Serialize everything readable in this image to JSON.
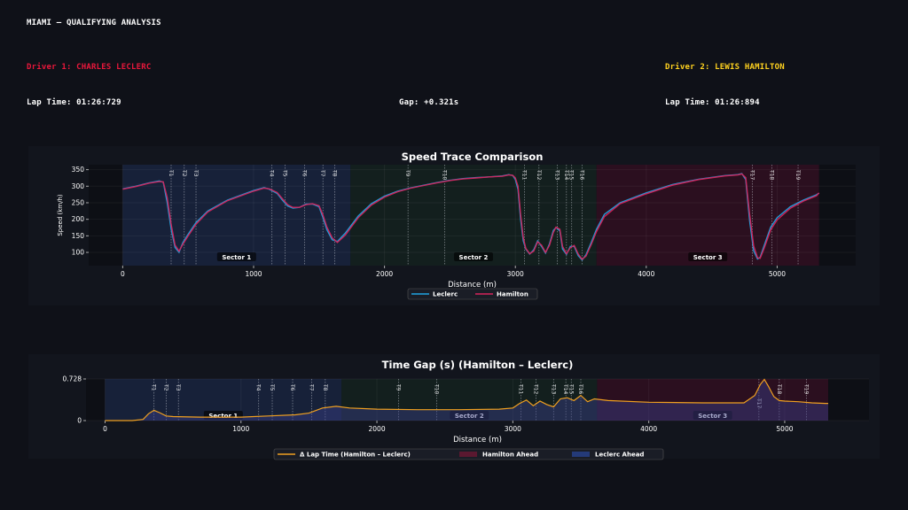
{
  "header": {
    "title": "MIAMI – QUALIFYING ANALYSIS",
    "driver1_label": "Driver 1: CHARLES LECLERC",
    "driver2_label": "Driver 2: LEWIS HAMILTON",
    "lap1": "Lap Time: 01:26:729",
    "gap": "Gap: +0.321s",
    "lap2": "Lap Time: 01:26:894"
  },
  "colors": {
    "background": "#0f1118",
    "panel": "#12151d",
    "leclerc": "#1fa3e0",
    "hamilton": "#d6245c",
    "gap_line": "#f0a020",
    "driver1": "#e8173b",
    "driver2": "#ffd21f",
    "sector1": "#18233d",
    "sector2": "#14211f",
    "sector3": "#2f1020"
  },
  "chart_data": [
    {
      "type": "line",
      "title": "Speed Trace Comparison",
      "xlabel": "Distance (m)",
      "ylabel": "Speed (km/h)",
      "xlim": [
        -260,
        5600
      ],
      "ylim": [
        60,
        365
      ],
      "xticks": [
        0,
        1000,
        2000,
        3000,
        4000,
        5000
      ],
      "yticks": [
        100,
        150,
        200,
        250,
        300,
        350
      ],
      "grid": true,
      "legend_placement": "bottom-center",
      "sectors": [
        {
          "label": "Sector 1",
          "start": 0,
          "end": 1740
        },
        {
          "label": "Sector 2",
          "start": 1740,
          "end": 3620
        },
        {
          "label": "Sector 3",
          "start": 3620,
          "end": 5320
        }
      ],
      "turns": [
        {
          "label": "T1",
          "x": 370
        },
        {
          "label": "T2",
          "x": 470
        },
        {
          "label": "T3",
          "x": 560
        },
        {
          "label": "T4",
          "x": 1140
        },
        {
          "label": "T5",
          "x": 1240
        },
        {
          "label": "T6",
          "x": 1390
        },
        {
          "label": "T7",
          "x": 1530
        },
        {
          "label": "T8",
          "x": 1620
        },
        {
          "label": "T9",
          "x": 2180
        },
        {
          "label": "T10",
          "x": 2460
        },
        {
          "label": "T11",
          "x": 3070
        },
        {
          "label": "T12",
          "x": 3180
        },
        {
          "label": "T13",
          "x": 3320
        },
        {
          "label": "T14",
          "x": 3390
        },
        {
          "label": "T15",
          "x": 3430
        },
        {
          "label": "T16",
          "x": 3510
        },
        {
          "label": "T17",
          "x": 4810
        },
        {
          "label": "T18",
          "x": 4960
        },
        {
          "label": "T19",
          "x": 5160
        }
      ],
      "series": [
        {
          "name": "Leclerc",
          "x": [
            0,
            100,
            200,
            280,
            310,
            340,
            370,
            400,
            430,
            460,
            500,
            560,
            650,
            800,
            1000,
            1080,
            1120,
            1180,
            1220,
            1260,
            1300,
            1350,
            1400,
            1450,
            1500,
            1530,
            1560,
            1600,
            1640,
            1700,
            1800,
            1900,
            2000,
            2100,
            2200,
            2300,
            2400,
            2500,
            2600,
            2700,
            2800,
            2900,
            2950,
            2980,
            3000,
            3020,
            3040,
            3060,
            3080,
            3110,
            3140,
            3170,
            3200,
            3230,
            3260,
            3290,
            3310,
            3340,
            3360,
            3390,
            3420,
            3450,
            3480,
            3510,
            3540,
            3580,
            3620,
            3680,
            3800,
            4000,
            4200,
            4400,
            4600,
            4700,
            4730,
            4760,
            4790,
            4820,
            4850,
            4870,
            4900,
            4950,
            5000,
            5100,
            5200,
            5300,
            5320
          ],
          "values": [
            292,
            300,
            310,
            316,
            312,
            250,
            170,
            115,
            100,
            130,
            155,
            190,
            225,
            258,
            287,
            296,
            291,
            278,
            258,
            240,
            234,
            236,
            246,
            246,
            238,
            205,
            168,
            138,
            133,
            158,
            210,
            247,
            270,
            285,
            295,
            303,
            311,
            318,
            323,
            326,
            328,
            331,
            335,
            332,
            320,
            290,
            200,
            135,
            110,
            95,
            108,
            135,
            118,
            98,
            125,
            166,
            175,
            165,
            110,
            94,
            118,
            118,
            90,
            77,
            93,
            130,
            170,
            215,
            250,
            280,
            305,
            321,
            332,
            335,
            338,
            320,
            195,
            105,
            80,
            85,
            120,
            176,
            205,
            238,
            258,
            274,
            279
          ]
        },
        {
          "name": "Hamilton",
          "x": [
            0,
            100,
            200,
            280,
            310,
            340,
            370,
            400,
            430,
            460,
            500,
            560,
            650,
            800,
            1000,
            1080,
            1120,
            1180,
            1220,
            1260,
            1300,
            1350,
            1400,
            1450,
            1500,
            1530,
            1560,
            1600,
            1640,
            1700,
            1800,
            1900,
            2000,
            2100,
            2200,
            2300,
            2400,
            2500,
            2600,
            2700,
            2800,
            2900,
            2950,
            2980,
            3000,
            3020,
            3040,
            3060,
            3080,
            3110,
            3140,
            3170,
            3200,
            3230,
            3260,
            3290,
            3310,
            3340,
            3360,
            3390,
            3420,
            3450,
            3480,
            3510,
            3540,
            3580,
            3620,
            3680,
            3800,
            4000,
            4200,
            4400,
            4600,
            4700,
            4730,
            4760,
            4790,
            4820,
            4850,
            4870,
            4900,
            4950,
            5000,
            5100,
            5200,
            5300,
            5320
          ],
          "values": [
            291,
            299,
            309,
            314,
            313,
            265,
            185,
            122,
            104,
            125,
            150,
            185,
            222,
            256,
            285,
            294,
            292,
            281,
            262,
            244,
            236,
            236,
            244,
            247,
            241,
            213,
            176,
            144,
            130,
            152,
            205,
            243,
            267,
            283,
            294,
            302,
            310,
            317,
            322,
            325,
            328,
            330,
            334,
            333,
            325,
            300,
            215,
            145,
            112,
            96,
            104,
            132,
            122,
            100,
            121,
            160,
            176,
            170,
            118,
            96,
            114,
            121,
            95,
            79,
            89,
            124,
            163,
            208,
            247,
            277,
            303,
            320,
            331,
            334,
            337,
            326,
            215,
            120,
            84,
            82,
            112,
            168,
            198,
            233,
            255,
            271,
            280
          ]
        }
      ]
    },
    {
      "type": "area",
      "title": "Time Gap (s) (Hamilton – Leclerc)",
      "xlabel": "Distance (m)",
      "ylabel": "",
      "xlim": [
        -140,
        5620
      ],
      "ylim": [
        0,
        0.728
      ],
      "xticks": [
        0,
        1000,
        2000,
        3000,
        4000,
        5000
      ],
      "yticks": [
        "0",
        "0.728"
      ],
      "grid": true,
      "legend_placement": "bottom-center",
      "legend": [
        "Δ Lap Time (Hamilton – Leclerc)",
        "Hamilton Ahead",
        "Leclerc Ahead"
      ],
      "sectors": [
        {
          "label": "Sector 1",
          "start": 0,
          "end": 1740
        },
        {
          "label": "Sector 2",
          "start": 1740,
          "end": 3620
        },
        {
          "label": "Sector 3",
          "start": 3620,
          "end": 5320
        }
      ],
      "turns": [
        {
          "label": "T1",
          "x": 360
        },
        {
          "label": "T2",
          "x": 450
        },
        {
          "label": "T3",
          "x": 540
        },
        {
          "label": "T4",
          "x": 1130
        },
        {
          "label": "T5",
          "x": 1230
        },
        {
          "label": "T6",
          "x": 1380
        },
        {
          "label": "T7",
          "x": 1520
        },
        {
          "label": "T8",
          "x": 1620
        },
        {
          "label": "T9",
          "x": 2160
        },
        {
          "label": "T10",
          "x": 2440
        },
        {
          "label": "T11",
          "x": 3060
        },
        {
          "label": "T12",
          "x": 3170
        },
        {
          "label": "T13",
          "x": 3300
        },
        {
          "label": "T14",
          "x": 3390
        },
        {
          "label": "T15",
          "x": 3430
        },
        {
          "label": "T16",
          "x": 3500
        },
        {
          "label": "T17",
          "x": 4810
        },
        {
          "label": "T18",
          "x": 4960
        },
        {
          "label": "T19",
          "x": 5160
        }
      ],
      "series": [
        {
          "name": "Δ Lap Time (Hamilton – Leclerc)",
          "x": [
            0,
            200,
            280,
            320,
            360,
            400,
            450,
            500,
            700,
            1000,
            1200,
            1400,
            1500,
            1600,
            1700,
            1800,
            2000,
            2300,
            2600,
            2900,
            3000,
            3050,
            3100,
            3150,
            3200,
            3250,
            3300,
            3350,
            3400,
            3450,
            3500,
            3550,
            3600,
            3700,
            4000,
            4400,
            4700,
            4780,
            4820,
            4850,
            4880,
            4920,
            4960,
            5000,
            5100,
            5200,
            5300,
            5320
          ],
          "values": [
            0.0,
            0.0,
            0.02,
            0.12,
            0.18,
            0.14,
            0.08,
            0.07,
            0.06,
            0.06,
            0.08,
            0.1,
            0.13,
            0.22,
            0.25,
            0.22,
            0.2,
            0.19,
            0.19,
            0.2,
            0.22,
            0.3,
            0.36,
            0.26,
            0.34,
            0.28,
            0.24,
            0.38,
            0.4,
            0.35,
            0.44,
            0.33,
            0.38,
            0.35,
            0.32,
            0.31,
            0.31,
            0.44,
            0.63,
            0.72,
            0.6,
            0.42,
            0.35,
            0.34,
            0.33,
            0.31,
            0.3,
            0.3
          ]
        }
      ]
    }
  ]
}
